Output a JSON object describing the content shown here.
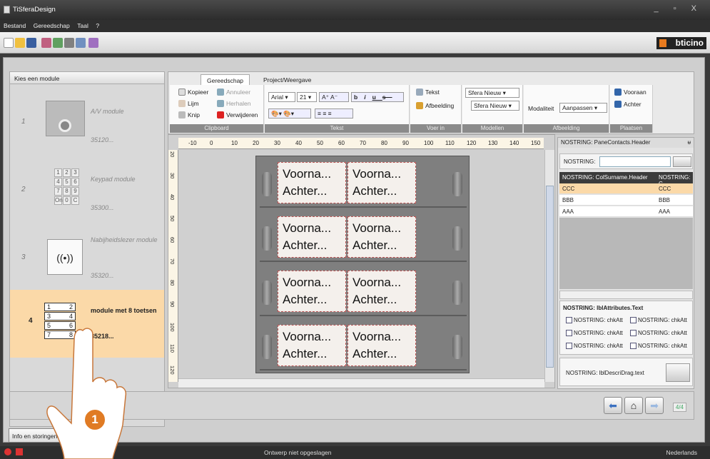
{
  "app": {
    "title": "TiSferaDesign",
    "logo": "bticino"
  },
  "menu": [
    "Bestand",
    "Gereedschap",
    "Taal",
    "?"
  ],
  "left": {
    "header": "Kies een module",
    "modules": [
      {
        "num": "1",
        "name": "A/V module",
        "code": "35120..."
      },
      {
        "num": "2",
        "name": "Keypad module",
        "code": "35300...",
        "keys": [
          "1",
          "2",
          "3",
          "4",
          "5",
          "6",
          "7",
          "8",
          "9",
          "On",
          "0",
          "C"
        ]
      },
      {
        "num": "3",
        "name": "Nabijheidslezer module",
        "code": "35320..."
      },
      {
        "num": "4",
        "name": "module met 8 toetsen",
        "code": "35218...",
        "keys": [
          "1",
          "2",
          "3",
          "4",
          "5",
          "6",
          "7",
          "8"
        ]
      }
    ]
  },
  "ribbon": {
    "tabs": [
      "Gereedschap",
      "Project/Weergave"
    ],
    "clipboard": {
      "label": "Clipboard",
      "items": [
        "Kopieer",
        "Annuleer",
        "Lijm",
        "Herhalen",
        "Knip",
        "Verwijderen"
      ]
    },
    "text": {
      "label": "Tekst",
      "font": "Arial",
      "size": "21",
      "btns": [
        "b",
        "i",
        "u",
        "s"
      ]
    },
    "insert": {
      "label": "Voer in",
      "items": [
        "Tekst",
        "Afbeelding"
      ]
    },
    "models": {
      "label": "Modellen",
      "a": "Sfera Nieuw",
      "b": "Sfera Nieuw"
    },
    "image": {
      "label": "Afbeelding",
      "mode_label": "Modaliteit",
      "mode": "Aanpassen"
    },
    "place": {
      "label": "Plaatsen",
      "items": [
        "Vooraan",
        "Achter"
      ]
    }
  },
  "ruler": {
    "h": [
      "-10",
      "0",
      "10",
      "20",
      "30",
      "40",
      "50",
      "60",
      "70",
      "80",
      "90",
      "100",
      "110",
      "120",
      "130",
      "140",
      "150"
    ],
    "v": [
      "20",
      "30",
      "40",
      "50",
      "60",
      "70",
      "80",
      "90",
      "100",
      "110",
      "120"
    ]
  },
  "panel": {
    "cells": [
      {
        "a": "Voorna...",
        "b": "Achter..."
      }
    ]
  },
  "right": {
    "header": "NOSTRING: PaneContacts.Header",
    "pin": "ᵾ",
    "search_label": "NOSTRING:",
    "col1": "NOSTRING: ColSurname.Header",
    "col2": "NOSTRING: C",
    "rows": [
      [
        "CCC",
        "CCC"
      ],
      [
        "BBB",
        "BBB"
      ],
      [
        "AAA",
        "AAA"
      ]
    ],
    "attrs_title": "NOSTRING: lblAttributes.Text",
    "chk": "NOSTRING: chkAtt",
    "descri": "NOSTRING: lblDescriDrag.text"
  },
  "nav": {
    "pages": "4/4"
  },
  "info_button": "Info en storingen",
  "status": {
    "text": "Ontwerp niet opgeslagen",
    "lang": "Nederlands"
  },
  "callout": "1"
}
